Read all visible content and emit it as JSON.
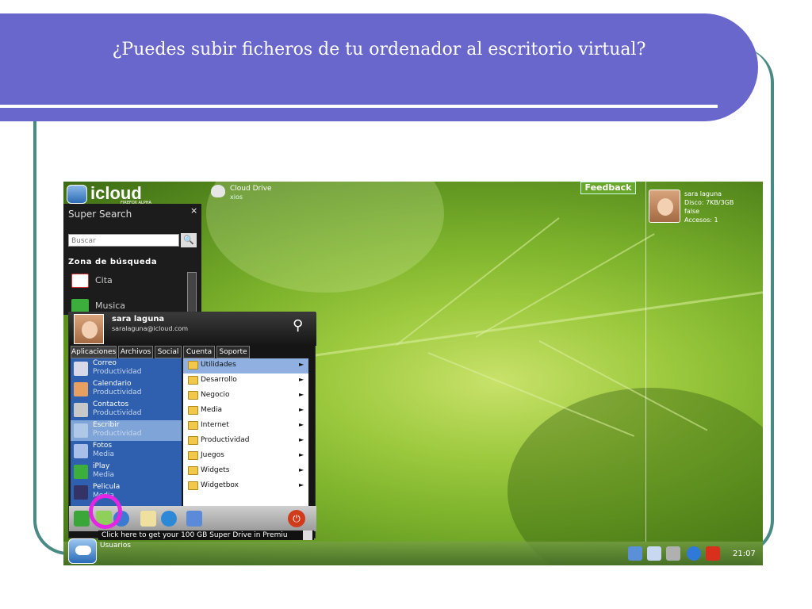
{
  "slide": {
    "title": "¿Puedes subir ficheros de tu ordenador al escritorio virtual?"
  },
  "desktop": {
    "logo": {
      "name": "icloud",
      "sub": "FIREFOX ALPHA"
    },
    "cloud_drive": {
      "title": "Cloud Drive",
      "subtitle": "xios"
    },
    "feedback_label": "Feedback",
    "profile": {
      "name": "sara laguna",
      "disk": "Disco: 7KB/3GB",
      "status": "false",
      "accesses": "Accesos: 1"
    },
    "super_search": {
      "title": "Super Search",
      "close": "×",
      "placeholder": "Buscar",
      "zone_label": "Zona de búsqueda",
      "items": [
        {
          "label": "Cita",
          "icon": "calendar-icon"
        },
        {
          "label": "Musica",
          "icon": "music-icon"
        }
      ]
    },
    "start_menu": {
      "user_name": "sara laguna",
      "user_email": "saralaguna@icloud.com",
      "tabs": [
        "Aplicaciones",
        "Archivos",
        "Social",
        "Cuenta",
        "Soporte"
      ],
      "apps": [
        {
          "name": "Correo",
          "category": "Productividad",
          "icon": "mail-icon",
          "color": "#d8d8e8"
        },
        {
          "name": "Calendario",
          "category": "Productividad",
          "icon": "calendar-icon",
          "color": "#e8a060"
        },
        {
          "name": "Contactos",
          "category": "Productividad",
          "icon": "contacts-icon",
          "color": "#c8c8c8"
        },
        {
          "name": "Escribir",
          "category": "Productividad",
          "icon": "write-icon",
          "color": "#b0c8e8"
        },
        {
          "name": "Fotos",
          "category": "Media",
          "icon": "photos-icon",
          "color": "#a8c0e8"
        },
        {
          "name": "iPlay",
          "category": "Media",
          "icon": "play-icon",
          "color": "#3cae3c"
        },
        {
          "name": "Pelicula",
          "category": "Media",
          "icon": "film-icon",
          "color": "#333366"
        }
      ],
      "folders": [
        {
          "label": "Utilidades"
        },
        {
          "label": "Desarrollo"
        },
        {
          "label": "Negocio"
        },
        {
          "label": "Media"
        },
        {
          "label": "Internet"
        },
        {
          "label": "Productividad"
        },
        {
          "label": "Juegos"
        },
        {
          "label": "Widgets"
        },
        {
          "label": "Widgetbox"
        }
      ],
      "arrow": "►",
      "quick_icons": [
        {
          "name": "share-icon",
          "color": "#3aa63a"
        },
        {
          "name": "upload-icon",
          "color": "#8fd05a"
        },
        {
          "name": "ie-icon",
          "color": "#3a7ad0"
        },
        {
          "name": "notes-icon",
          "color": "#f0e0a0"
        },
        {
          "name": "globe-icon",
          "color": "#2e88d8"
        },
        {
          "name": "check-icon",
          "color": "#5a8ad8"
        }
      ],
      "power": "⏻"
    },
    "promo_text": "Click here to get your 100 GB Super Drive in Premiu",
    "taskbar": {
      "label": "Usuarios",
      "clock": "21:07",
      "tray_icons": [
        {
          "name": "network-icon",
          "color": "#5b8fd8"
        },
        {
          "name": "users-icon",
          "color": "#c8d8f0"
        },
        {
          "name": "settings-icon",
          "color": "#b0b0b0"
        },
        {
          "name": "gear-icon",
          "color": "#2f7ad8"
        },
        {
          "name": "flag-es-icon",
          "color": "#d8301c"
        }
      ]
    }
  }
}
